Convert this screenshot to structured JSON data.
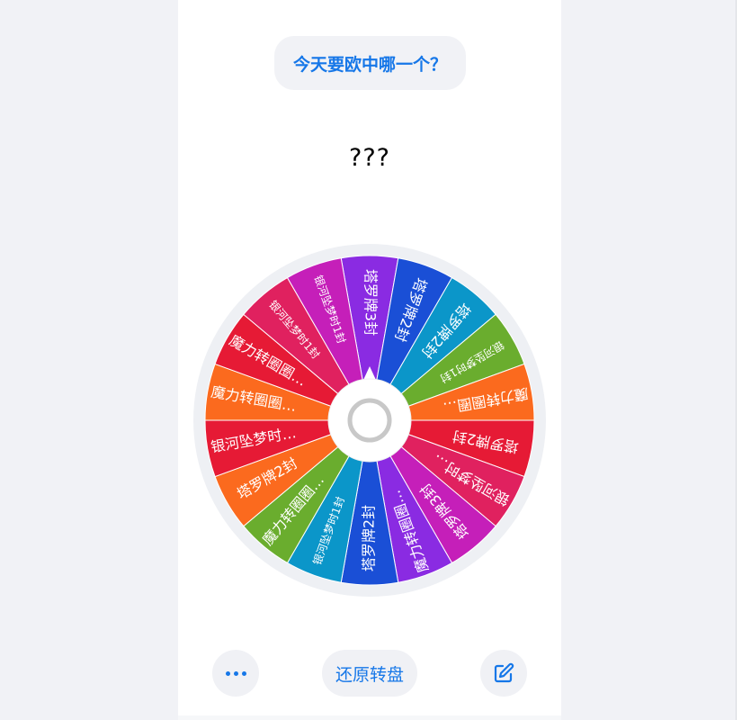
{
  "header": {
    "question": "今天要欧中哪一个？"
  },
  "result": {
    "text": "???"
  },
  "wheel": {
    "segments": [
      {
        "label": "塔罗牌3封",
        "color": "#8a2be2"
      },
      {
        "label": "塔罗牌2封",
        "color": "#1a4fd6"
      },
      {
        "label": "塔罗牌2封",
        "color": "#0b96c9"
      },
      {
        "label": "银河坠梦时1封",
        "color": "#6aad2e"
      },
      {
        "label": "魔力转圈圈…",
        "color": "#fb6a1e"
      },
      {
        "label": "塔罗牌2封",
        "color": "#e61a35"
      },
      {
        "label": "银河坠梦时…",
        "color": "#e0215f"
      },
      {
        "label": "塔罗牌3封",
        "color": "#c51fb9"
      },
      {
        "label": "魔力转圈圈…",
        "color": "#8a2be2"
      },
      {
        "label": "塔罗牌2封",
        "color": "#1a4fd6"
      },
      {
        "label": "银河坠梦时1封",
        "color": "#0b96c9"
      },
      {
        "label": "魔力转圈圈…",
        "color": "#6aad2e"
      },
      {
        "label": "塔罗牌2封",
        "color": "#fb6a1e"
      },
      {
        "label": "银河坠梦时…",
        "color": "#e61a35"
      },
      {
        "label": "魔力转圈圈…",
        "color": "#fb6a1e"
      },
      {
        "label": "魔力转圈圈…",
        "color": "#e61a35"
      },
      {
        "label": "银河坠梦时1封",
        "color": "#e0215f"
      },
      {
        "label": "银河坠梦时1封",
        "color": "#c51fb9"
      }
    ]
  },
  "footer": {
    "more_icon": "more-dots-icon",
    "reset_label": "还原转盘",
    "edit_icon": "edit-icon"
  },
  "colors": {
    "accent": "#1677e8",
    "pill_bg": "#f1f2f6"
  }
}
